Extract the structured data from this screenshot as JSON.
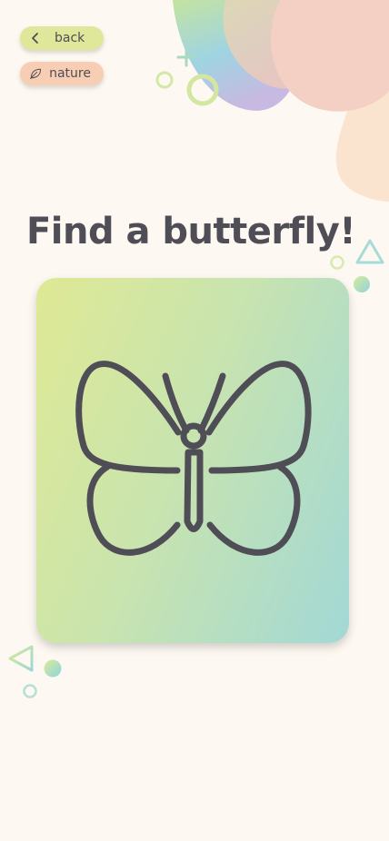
{
  "nav": {
    "back_label": "back",
    "back_icon": "chevron-left-icon",
    "category_label": "nature",
    "category_icon": "leaf-icon"
  },
  "prompt": {
    "title": "Find a butterfly!"
  },
  "card": {
    "illustration": "butterfly-icon"
  },
  "colors": {
    "background": "#fdf8f1",
    "text": "#4f4d55",
    "back_pill": "#dfe89a",
    "category_pill": "#f7cdb3",
    "card_gradient_start": "#dfe994",
    "card_gradient_end": "#a2d8d6"
  }
}
